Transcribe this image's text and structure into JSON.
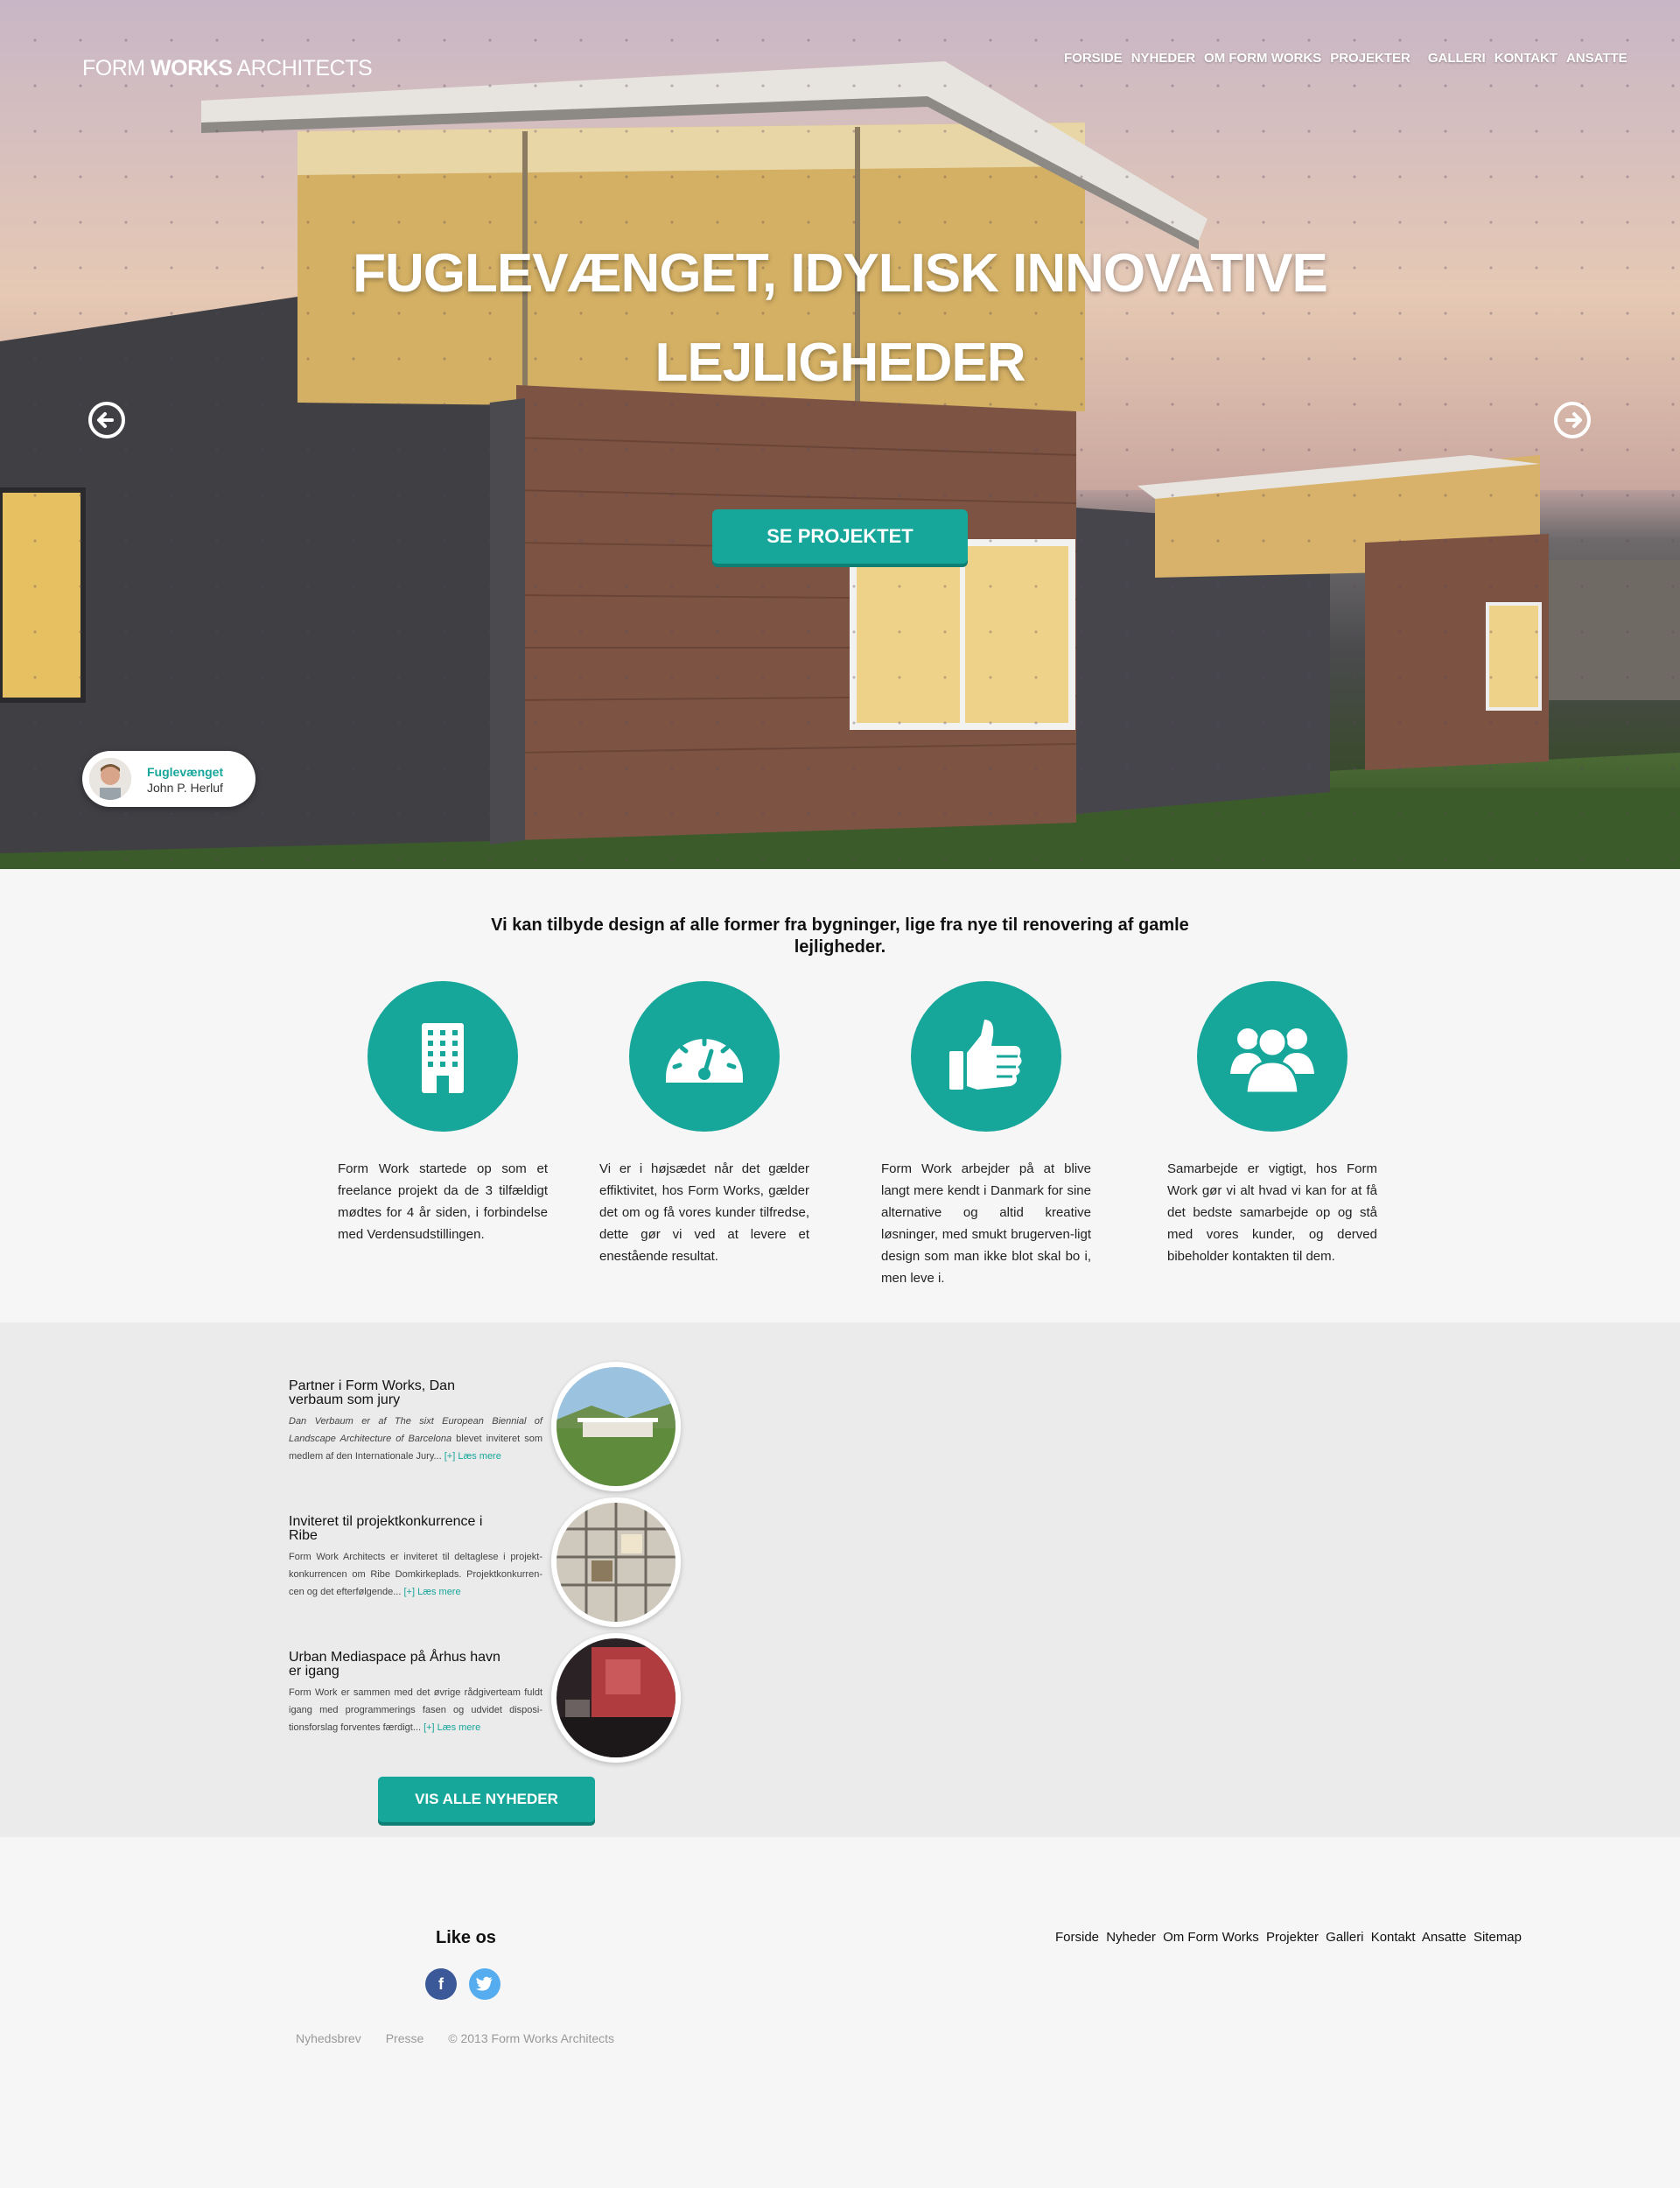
{
  "brand": {
    "logo_light_1": "FORM ",
    "logo_bold": "WORKS",
    "logo_light_2": " ARCHITECTS"
  },
  "nav": [
    "FORSIDE",
    "NYHEDER",
    "OM FORM WORKS",
    "PROJEKTER",
    "GALLERI",
    "KONTAKT",
    "ANSATTE"
  ],
  "hero": {
    "title_line1": "FUGLEVÆNGET, IDYLISK INNOVATIVE",
    "title_line2": "LEJLIGHEDER",
    "cta": "SE PROJEKTET",
    "credit_title": "Fuglevænget",
    "credit_name": "John P. Herluf",
    "prev_icon": "arrow-left-circle-icon",
    "next_icon": "arrow-right-circle-icon"
  },
  "features": {
    "intro": "Vi kan tilbyde design af alle former fra bygninger, lige fra nye til renovering af gamle lejligheder.",
    "items": [
      {
        "icon": "building-icon",
        "text": "Form Work startede op som et freelance projekt da de 3 tilfældigt mødtes for 4 år siden, i forbindelse med Verdensudstillingen."
      },
      {
        "icon": "speedometer-icon",
        "text": "Vi er i højsædet når det gælder effiktivitet, hos Form Works, gælder det om og få vores kunder tilfredse, dette gør vi ved at levere et enestående resultat."
      },
      {
        "icon": "thumbs-up-icon",
        "text": "Form Work arbejder på at blive langt mere kendt i Danmark for sine alternative og altid kreative løsninger, med smukt brugerven-ligt design som man ikke blot skal bo i, men leve i."
      },
      {
        "icon": "users-group-icon",
        "text": "Samarbejde er vigtigt, hos Form Work gør vi alt hvad vi kan for at få det bedste samarbejde op og stå med vores kunder, og derved bibeholder kontakten til dem."
      }
    ]
  },
  "news": {
    "items": [
      {
        "title": "Partner i Form Works, Dan verbaum som jury",
        "text_a": "Dan Verbaum er af The sixt European Biennial of Landscape Architecture of Barcelona",
        "text_b": " blevet inviteret som medlem af den Internationale Jury...",
        "more": " [+] Læs mere"
      },
      {
        "title": "Inviteret til projektkonkurrence i Ribe",
        "text_a": "",
        "text_b": "Form Work Architects er inviteret til deltaglese i projekt-konkurrencen om Ribe Domkirkeplads. Projektkonkurren-cen og det efterfølgende...",
        "more": " [+] Læs mere"
      },
      {
        "title": "Urban Mediaspace på Århus havn er igang",
        "text_a": "",
        "text_b": "Form Work er sammen med det øvrige rådgiverteam fuldt igang med programmerings fasen og udvidet disposi-tionsforslag forventes færdigt...",
        "more": " [+] Læs mere"
      }
    ],
    "button": "VIS ALLE NYHEDER"
  },
  "footer": {
    "like": "Like os",
    "facebook_icon": "facebook-icon",
    "twitter_icon": "twitter-icon",
    "nav": [
      "Forside",
      "Nyheder",
      "Om Form Works ",
      "Projekter",
      "Galleri",
      "Kontakt",
      "Ansatte",
      "Sitemap"
    ],
    "links": [
      "Nyhedsbrev",
      "Presse",
      "© 2013 Form Works Architects"
    ]
  },
  "colors": {
    "accent": "#17a69a",
    "accent_dark": "#0f7f76",
    "facebook": "#3b5998",
    "twitter": "#55acee"
  }
}
